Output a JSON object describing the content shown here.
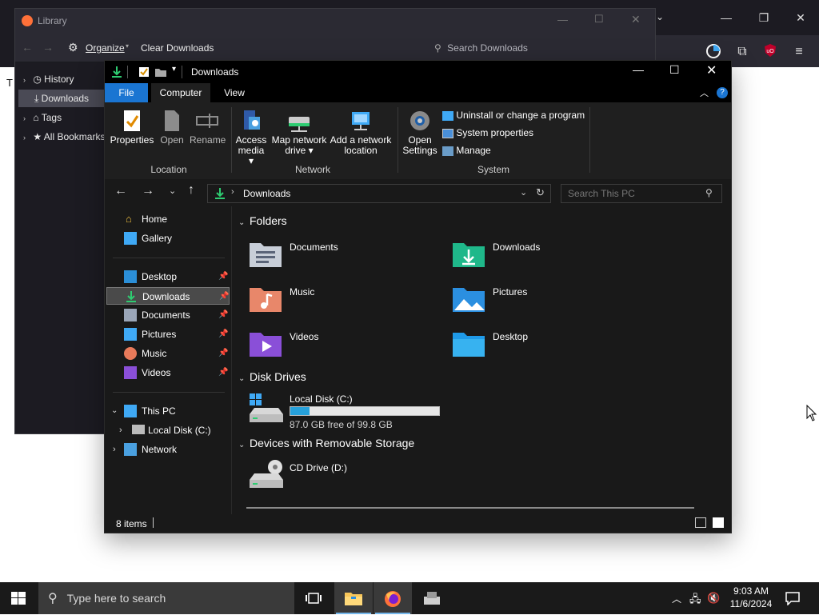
{
  "firefox": {
    "left_char": "T",
    "window_controls": {
      "minimize": "—",
      "restore": "❐",
      "close": "✕"
    }
  },
  "library": {
    "title": "Library",
    "toolbar": {
      "organize": "Organize",
      "clear_downloads": "Clear Downloads",
      "search_placeholder": "Search Downloads"
    },
    "sidebar": [
      {
        "label": "History"
      },
      {
        "label": "Downloads",
        "selected": true
      },
      {
        "label": "Tags"
      },
      {
        "label": "All Bookmarks"
      }
    ]
  },
  "explorer": {
    "title": "Downloads",
    "tabs": {
      "file": "File",
      "computer": "Computer",
      "view": "View"
    },
    "ribbon": {
      "location": {
        "label": "Location",
        "buttons": {
          "properties": "Properties",
          "open": "Open",
          "rename": "Rename"
        }
      },
      "network": {
        "label": "Network",
        "buttons": {
          "access_media_1": "Access",
          "access_media_2": "media ▾",
          "map_drive_1": "Map network",
          "map_drive_2": "drive ▾",
          "add_location_1": "Add a network",
          "add_location_2": "location"
        }
      },
      "system": {
        "label": "System",
        "open_settings_1": "Open",
        "open_settings_2": "Settings",
        "uninstall": "Uninstall or change a program",
        "properties": "System properties",
        "manage": "Manage"
      }
    },
    "address": {
      "path": "Downloads",
      "search_placeholder": "Search This PC"
    },
    "nav": {
      "home": "Home",
      "gallery": "Gallery",
      "pinned": [
        {
          "label": "Desktop"
        },
        {
          "label": "Downloads",
          "selected": true
        },
        {
          "label": "Documents"
        },
        {
          "label": "Pictures"
        },
        {
          "label": "Music"
        },
        {
          "label": "Videos"
        }
      ],
      "this_pc": "This PC",
      "local_disk": "Local Disk (C:)",
      "network": "Network"
    },
    "content": {
      "folders_header": "Folders",
      "folders": [
        {
          "name": "Documents"
        },
        {
          "name": "Downloads"
        },
        {
          "name": "Music"
        },
        {
          "name": "Pictures"
        },
        {
          "name": "Videos"
        },
        {
          "name": "Desktop"
        }
      ],
      "drives_header": "Disk Drives",
      "drive": {
        "name": "Local Disk (C:)",
        "free_text": "87.0 GB free of 99.8 GB",
        "used_fraction": 0.128
      },
      "removable_header": "Devices with Removable Storage",
      "cd": {
        "name": "CD Drive (D:)"
      }
    },
    "status": {
      "items": "8 items"
    }
  },
  "taskbar": {
    "search_placeholder": "Type here to search",
    "time": "9:03 AM",
    "date": "11/6/2024"
  },
  "colors": {
    "accent": "#0078d4",
    "folder_yellow": "#f8c659",
    "drive_bar": "#26a0da"
  }
}
